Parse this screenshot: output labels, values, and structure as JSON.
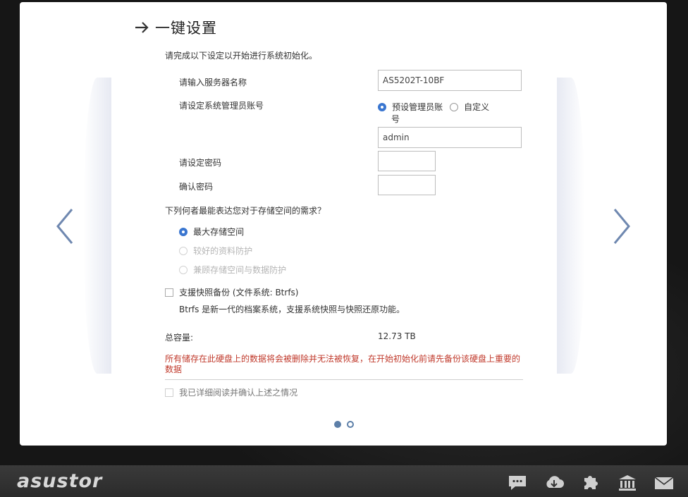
{
  "header": {
    "title": "一键设置"
  },
  "form": {
    "intro": "请完成以下设定以开始进行系统初始化。",
    "server_name_label": "请输入服务器名称",
    "server_name_value": "AS5202T-10BF",
    "admin_account_label": "请设定系统管理员账号",
    "admin_default_option_line1": "预设管理员账",
    "admin_default_option_line2": "号",
    "admin_custom_option": "自定义",
    "admin_value": "admin",
    "password_label": "请设定密码",
    "confirm_password_label": "确认密码",
    "storage_question": "下列何者最能表达您对于存储空间的需求？",
    "storage_options": [
      "最大存储空间",
      "较好的资料防护",
      "兼顾存储空间与数据防护"
    ],
    "snapshot_checkbox": "支援快照备份 (文件系统: Btrfs)",
    "btrfs_note": "Btrfs 是新一代的档案系统，支援系统快照与快照还原功能。",
    "total_capacity_label": "总容量:",
    "total_capacity_value": "12.73 TB",
    "warning": "所有储存在此硬盘上的数据将会被删除并无法被恢复，在开始初始化前请先备份该硬盘上重要的数据",
    "confirm_checkbox": "我已详细阅读并确认上述之情况"
  },
  "footer": {
    "logo": "asustor"
  },
  "colors": {
    "accent": "#3a76d0",
    "warning": "#c0392b",
    "nav": "#5d7fa8"
  },
  "icons": [
    "chat-icon",
    "cloud-download-icon",
    "puzzle-icon",
    "bank-icon",
    "mail-icon"
  ]
}
